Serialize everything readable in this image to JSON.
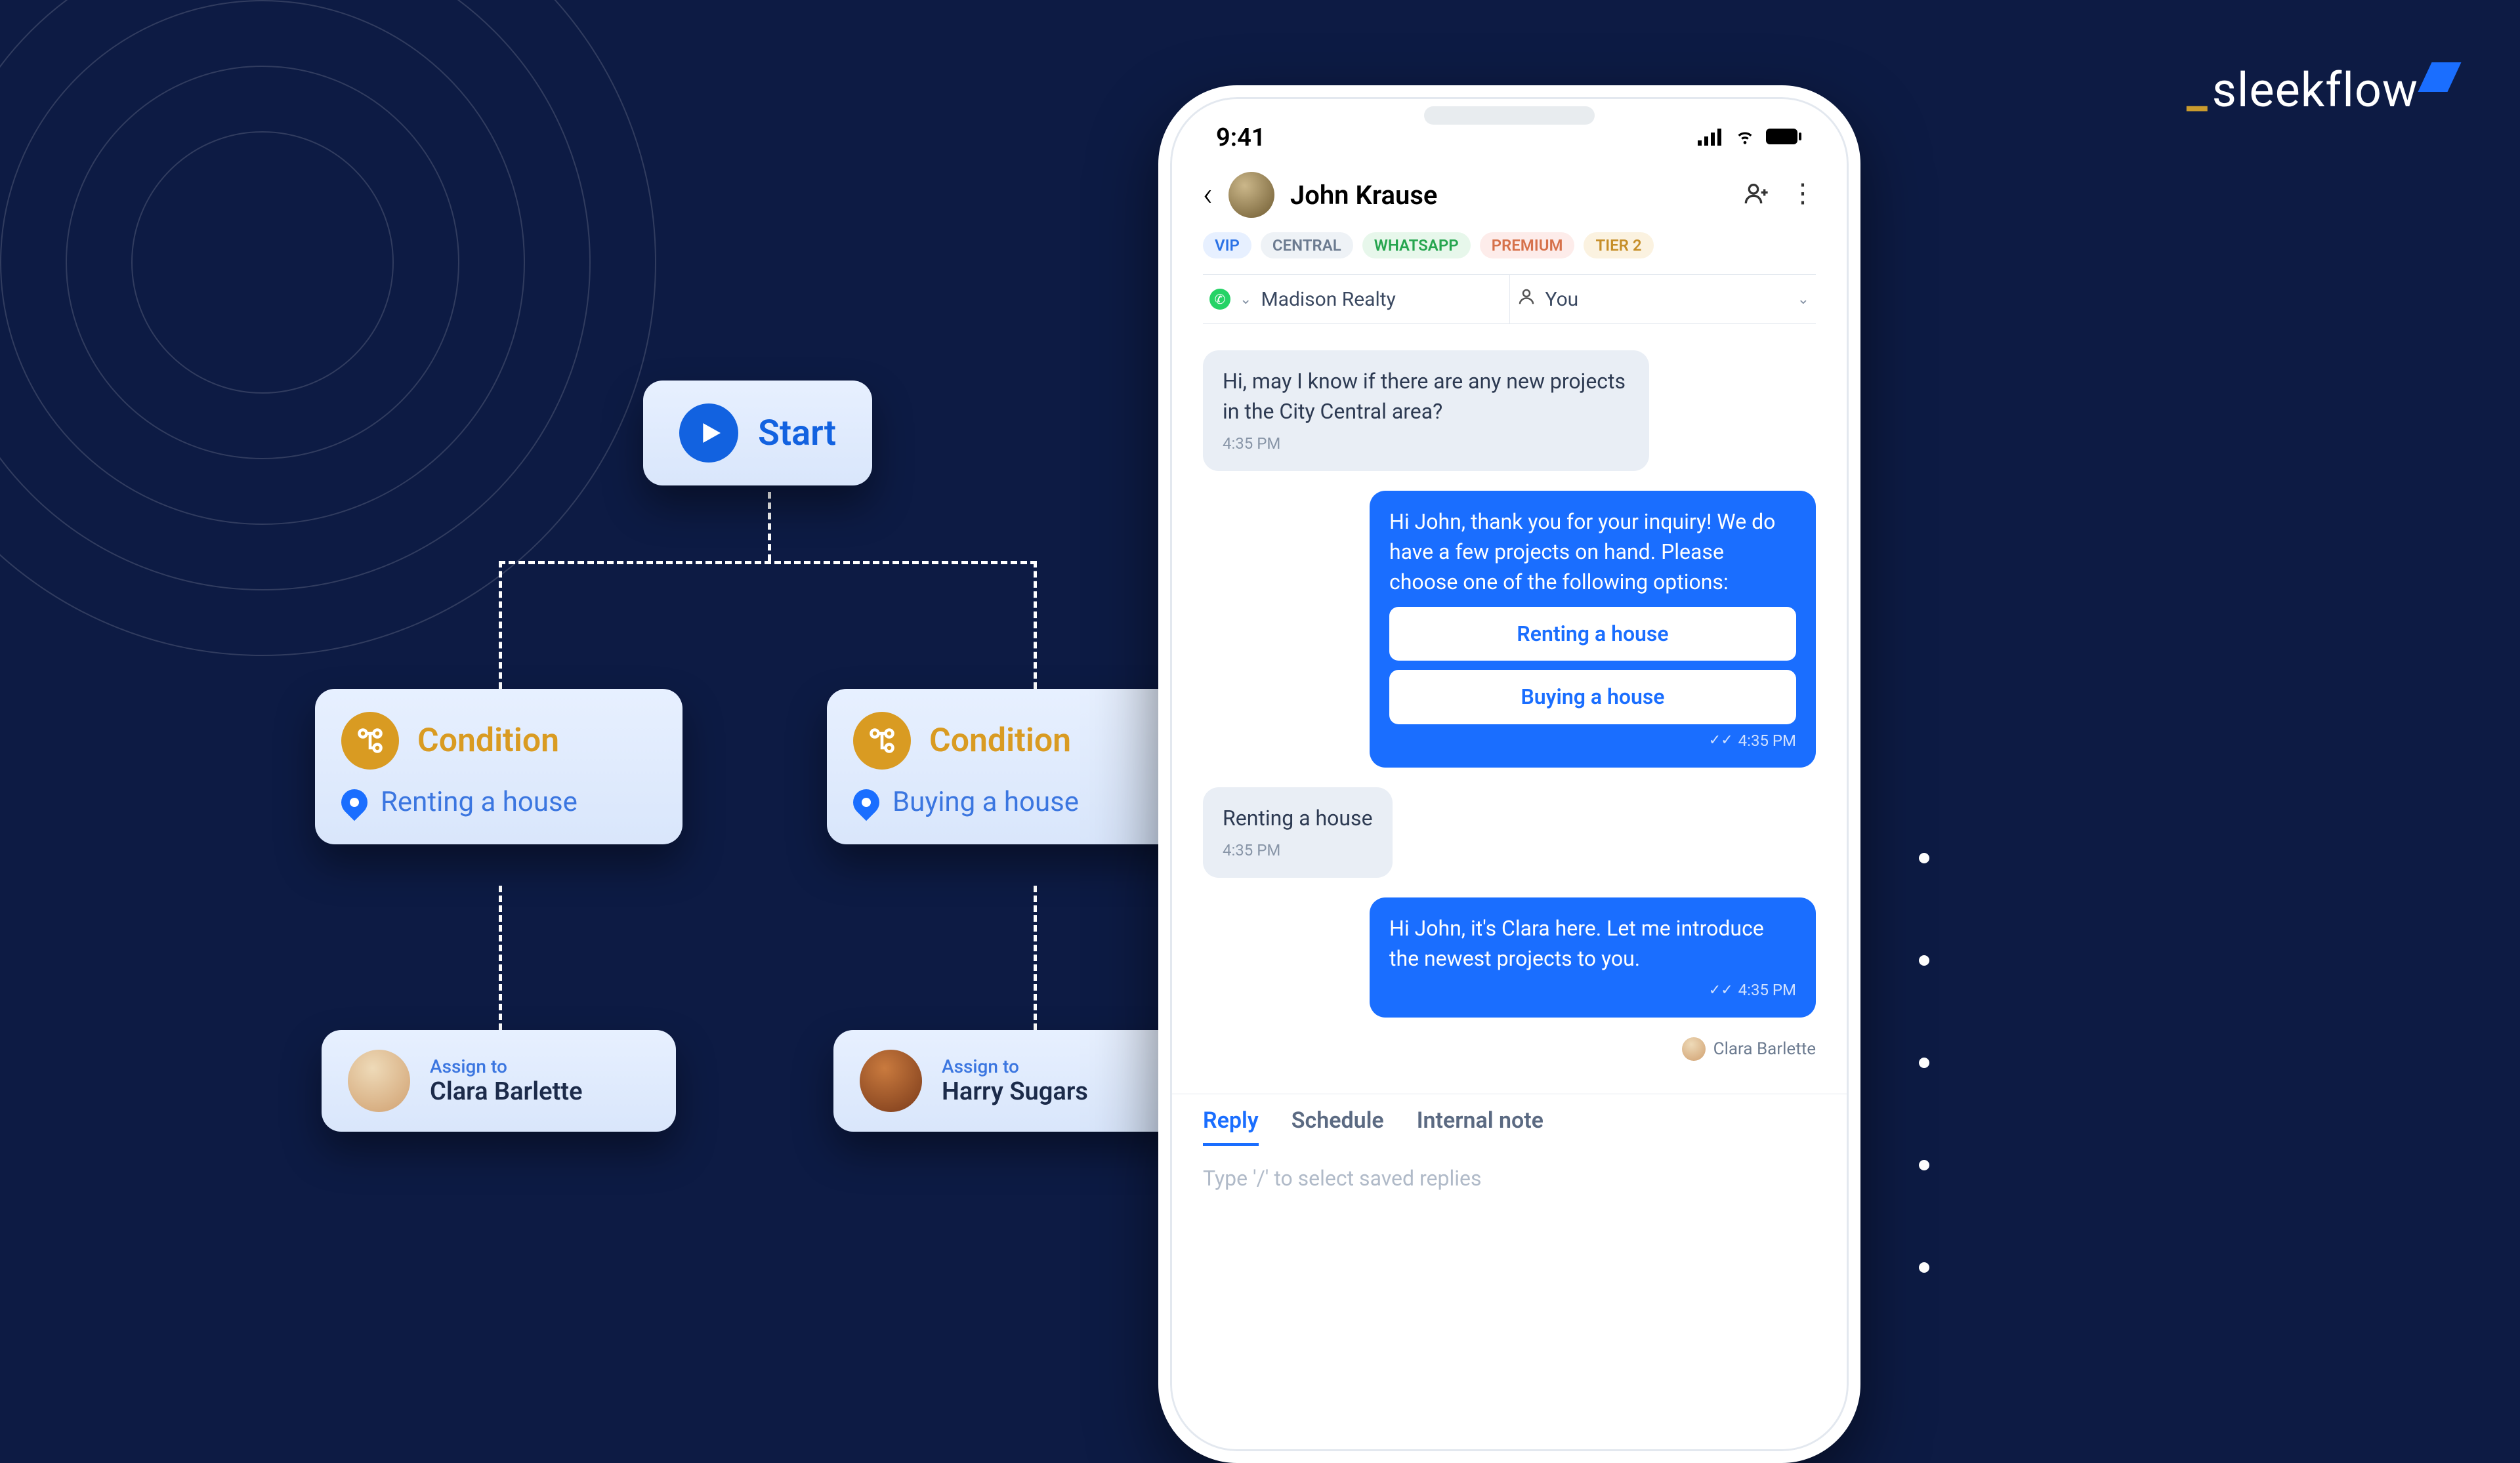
{
  "brand": {
    "name": "sleekflow"
  },
  "flow": {
    "start_label": "Start",
    "conditions": [
      {
        "title": "Condition",
        "value": "Renting a house"
      },
      {
        "title": "Condition",
        "value": "Buying a house"
      }
    ],
    "assigns": [
      {
        "label": "Assign to",
        "name": "Clara Barlette"
      },
      {
        "label": "Assign to",
        "name": "Harry Sugars"
      }
    ]
  },
  "phone": {
    "time": "9:41",
    "contact_name": "John Krause",
    "tags": {
      "vip": "VIP",
      "central": "CENTRAL",
      "whatsapp": "WHATSAPP",
      "premium": "PREMIUM",
      "tier2": "TIER 2"
    },
    "channel": "Madison Realty",
    "assignee": "You",
    "messages": {
      "m1": {
        "text": "Hi, may I know if there are any new projects in the City Central area?",
        "time": "4:35 PM"
      },
      "m2": {
        "text": "Hi John, thank you for your inquiry! We do have a few projects on hand. Please choose one of the following options:",
        "opt1": "Renting a house",
        "opt2": "Buying a house",
        "time": "4:35 PM"
      },
      "m3": {
        "text": "Renting a house",
        "time": "4:35 PM"
      },
      "m4": {
        "text": "Hi John, it's Clara here. Let me introduce the newest projects to you.",
        "time": "4:35 PM"
      }
    },
    "agent_name": "Clara Barlette",
    "composer": {
      "reply": "Reply",
      "schedule": "Schedule",
      "internal": "Internal note",
      "placeholder": "Type '/' to select saved replies"
    }
  }
}
